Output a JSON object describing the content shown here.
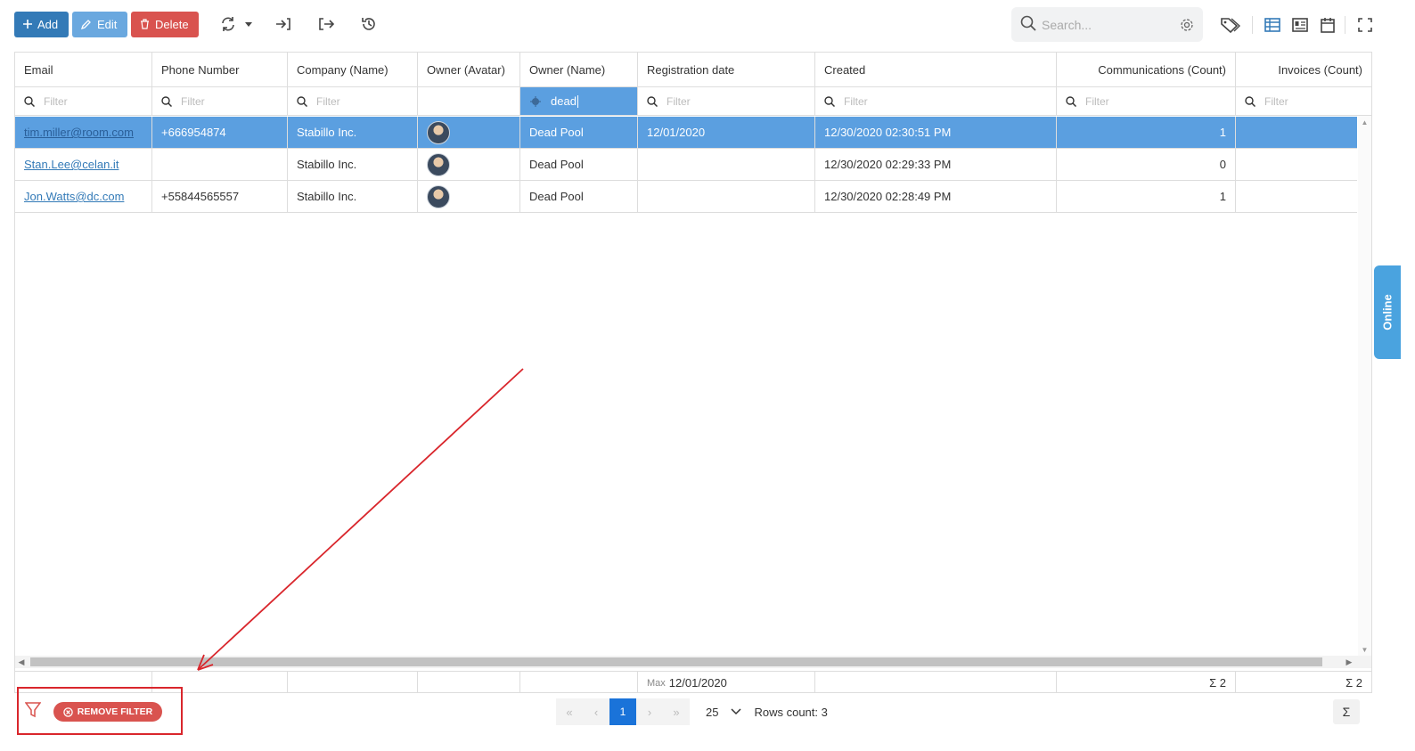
{
  "toolbar": {
    "add_label": "Add",
    "edit_label": "Edit",
    "delete_label": "Delete"
  },
  "search": {
    "placeholder": "Search..."
  },
  "grid": {
    "columns": [
      "Email",
      "Phone Number",
      "Company (Name)",
      "Owner (Avatar)",
      "Owner (Name)",
      "Registration date",
      "Created",
      "Communications (Count)",
      "Invoices (Count)"
    ],
    "filter_placeholder": "Filter",
    "owner_filter_value": "dead",
    "rows": [
      {
        "email": "tim.miller@room.com",
        "phone": "+666954874",
        "company": "Stabillo Inc.",
        "owner": "Dead Pool",
        "registration": "12/01/2020",
        "created": "12/30/2020 02:30:51 PM",
        "communications": "1",
        "selected": true
      },
      {
        "email": "Stan.Lee@celan.it",
        "phone": "",
        "company": "Stabillo Inc.",
        "owner": "Dead Pool",
        "registration": "",
        "created": "12/30/2020 02:29:33 PM",
        "communications": "0",
        "selected": false
      },
      {
        "email": "Jon.Watts@dc.com",
        "phone": "+55844565557",
        "company": "Stabillo Inc.",
        "owner": "Dead Pool",
        "registration": "",
        "created": "12/30/2020 02:28:49 PM",
        "communications": "1",
        "selected": false
      }
    ],
    "summary": {
      "registration_label": "Max",
      "registration_value": "12/01/2020",
      "communications_value": "Σ 2",
      "invoices_value": "Σ 2"
    }
  },
  "footer": {
    "remove_filter_label": "REMOVE FILTER",
    "current_page": "1",
    "page_size": "25",
    "rows_count": "Rows count: 3",
    "sigma": "Σ"
  },
  "side_tab": {
    "label": "Online"
  },
  "colors": {
    "primary": "#337ab7",
    "danger": "#d9534f",
    "selected_row": "#5b9fe0",
    "annotation": "#d9262c"
  }
}
